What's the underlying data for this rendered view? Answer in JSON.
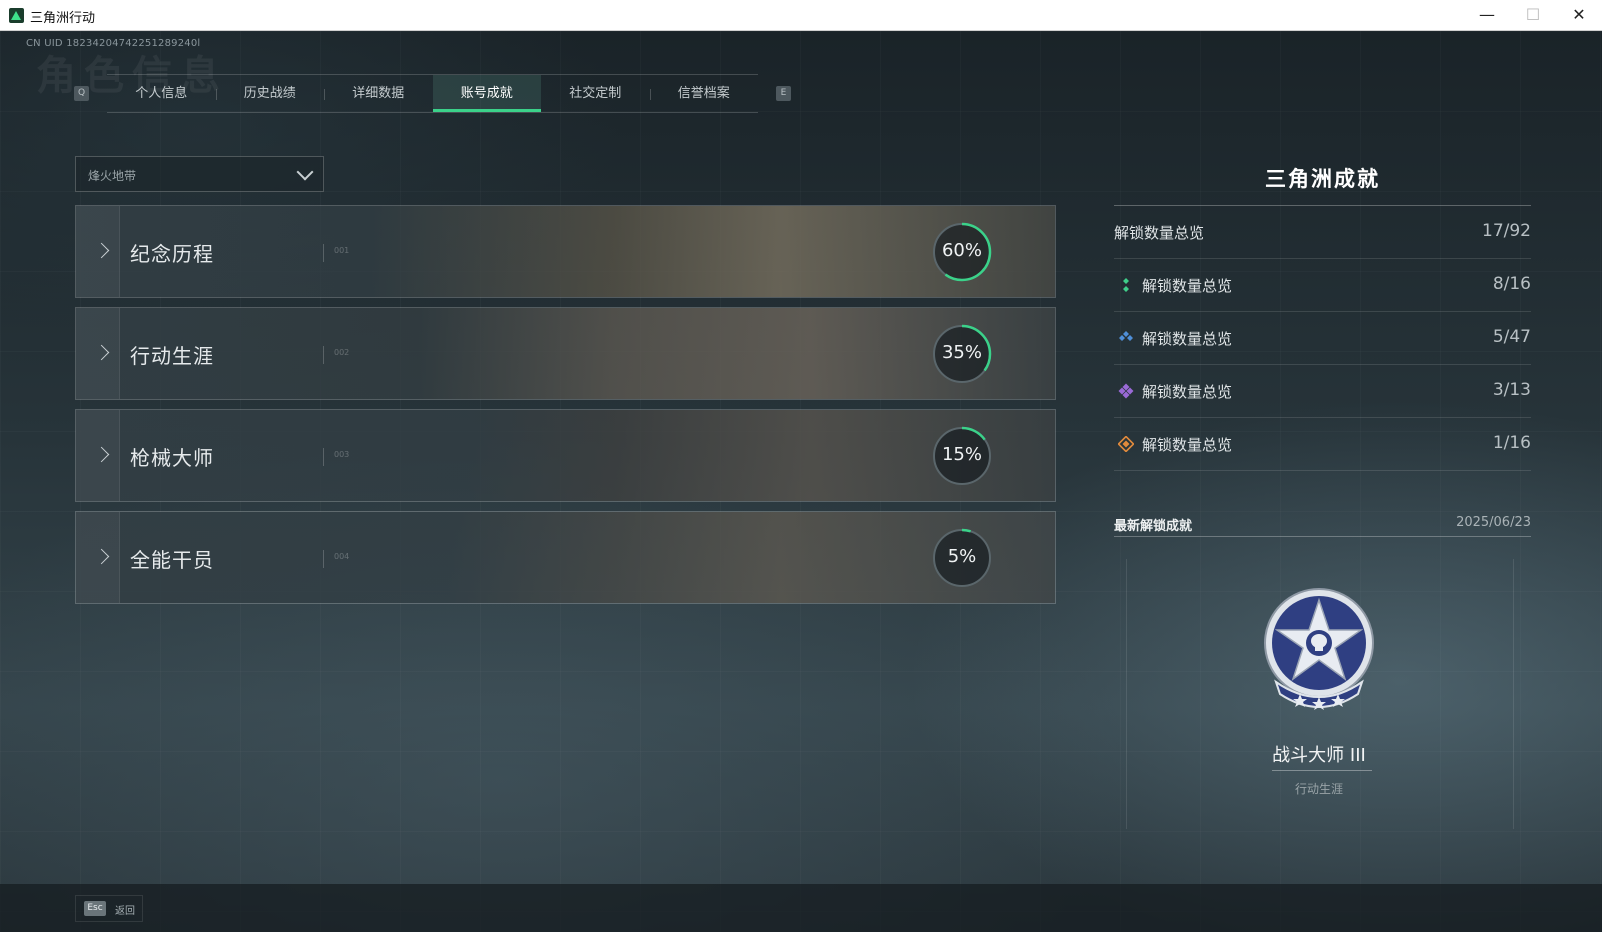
{
  "window": {
    "title": "三角洲行动",
    "min_glyph": "—",
    "max_glyph": "☐",
    "close_glyph": "✕"
  },
  "header": {
    "uid": "CN UID 18234204742251289240l",
    "ghost_title": "角色信息"
  },
  "tabs": {
    "prev_key": "Q",
    "next_key": "E",
    "items": [
      {
        "label": "个人信息",
        "active": false
      },
      {
        "label": "历史战绩",
        "active": false
      },
      {
        "label": "详细数据",
        "active": false
      },
      {
        "label": "账号成就",
        "active": true
      },
      {
        "label": "社交定制",
        "active": false
      },
      {
        "label": "信誉档案",
        "active": false
      }
    ]
  },
  "mode_select": {
    "value": "烽火地带"
  },
  "categories": [
    {
      "name": "纪念历程",
      "index": "001",
      "progress": 60,
      "progress_label": "60%"
    },
    {
      "name": "行动生涯",
      "index": "002",
      "progress": 35,
      "progress_label": "35%"
    },
    {
      "name": "枪械大师",
      "index": "003",
      "progress": 15,
      "progress_label": "15%"
    },
    {
      "name": "全能干员",
      "index": "004",
      "progress": 5,
      "progress_label": "5%"
    }
  ],
  "summary": {
    "title": "三角洲成就",
    "total": {
      "label": "解锁数量总览",
      "value": "17/92"
    },
    "tiers": [
      {
        "label": "解锁数量总览",
        "value": "8/16",
        "color": "#3fcf8a",
        "icon": "green-gem-icon"
      },
      {
        "label": "解锁数量总览",
        "value": "5/47",
        "color": "#4f8fd8",
        "icon": "blue-gem-icon"
      },
      {
        "label": "解锁数量总览",
        "value": "3/13",
        "color": "#9a6ad6",
        "icon": "purple-gem-icon"
      },
      {
        "label": "解锁数量总览",
        "value": "1/16",
        "color": "#e08a3c",
        "icon": "orange-gem-icon"
      }
    ]
  },
  "latest": {
    "label": "最新解锁成就",
    "date": "2025/06/23",
    "achievement_name": "战斗大师 III",
    "achievement_category": "行动生涯",
    "badge_icon": "star-skull-badge-icon"
  },
  "footer": {
    "key": "Esc",
    "label": "返回"
  },
  "colors": {
    "accent": "#3bd28a",
    "ring_track": "#5a666b"
  }
}
